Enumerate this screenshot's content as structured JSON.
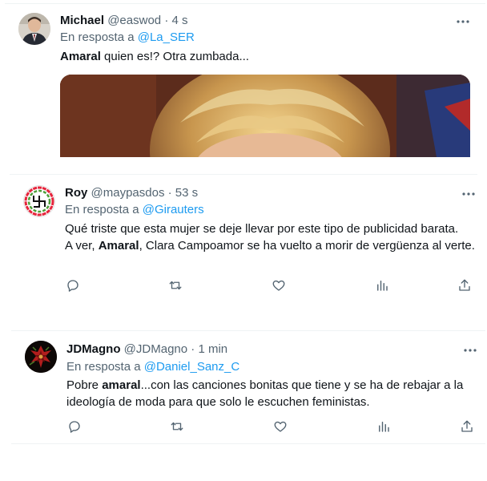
{
  "tweets": [
    {
      "author_name": "Michael",
      "handle": "@easwod",
      "time": "4 s",
      "reply_prefix": "En resposta a",
      "reply_mention": "@La_SER",
      "text_bold": "Amaral",
      "text_rest": " quien es!? Otra zumbada..."
    },
    {
      "author_name": "Roy",
      "handle": "@maypasdos",
      "time": "53 s",
      "reply_prefix": "En resposta a",
      "reply_mention": "@Girauters",
      "text_line1": "Qué triste que esta mujer se deje llevar por este tipo de publicidad barata.",
      "text_line2_pre": "A ver, ",
      "text_line2_bold": "Amaral",
      "text_line2_post": ", Clara Campoamor se  ha vuelto a morir de vergüenza al verte."
    },
    {
      "author_name": "JDMagno",
      "handle": "@JDMagno",
      "time": "1 min",
      "reply_prefix": "En resposta a",
      "reply_mention": "@Daniel_Sanz_C",
      "text_pre": "Pobre ",
      "text_bold": "amaral",
      "text_post": "...con las canciones bonitas que tiene y se ha de rebajar a la ideología de moda para que solo le escuchen feministas."
    }
  ],
  "separator": "·",
  "colors": {
    "text": "#0f1419",
    "muted": "#536471",
    "link": "#1d9bf0",
    "border": "#eff3f4"
  },
  "icons": [
    "more-icon",
    "reply-icon",
    "retweet-icon",
    "like-icon",
    "views-icon",
    "share-icon"
  ]
}
